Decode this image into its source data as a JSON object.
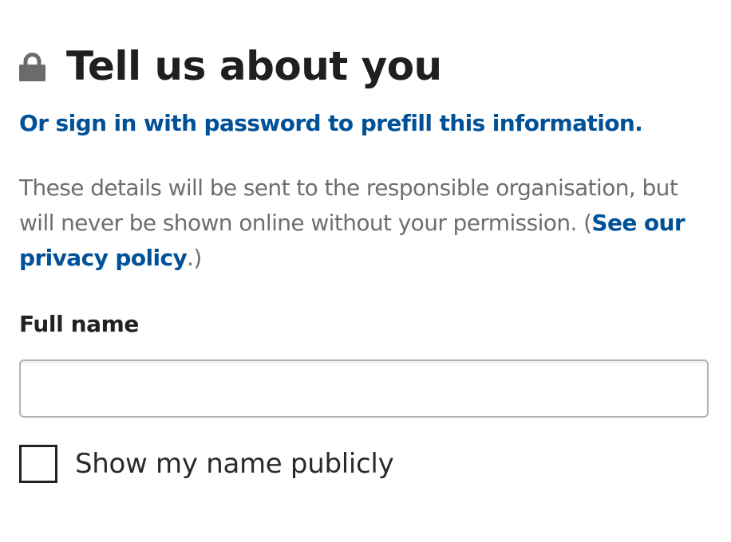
{
  "section": {
    "title": "Tell us about you",
    "lock_icon": "lock-icon",
    "signin_link": "Or sign in with password to prefill this information."
  },
  "info": {
    "text_before": "These details will be sent to the responsible organisation, but will never be shown online without your permission. (",
    "privacy_link": "See our privacy policy",
    "text_after": ".)"
  },
  "form": {
    "full_name": {
      "label": "Full name",
      "value": "",
      "placeholder": ""
    },
    "show_name_publicly": {
      "label": "Show my name publicly",
      "checked": false
    }
  },
  "colors": {
    "link": "#005197",
    "heading": "#1f1f1f",
    "muted_text": "#6e6e6e",
    "input_border": "#b4b4b4",
    "lock_icon": "#6b6b6b"
  }
}
